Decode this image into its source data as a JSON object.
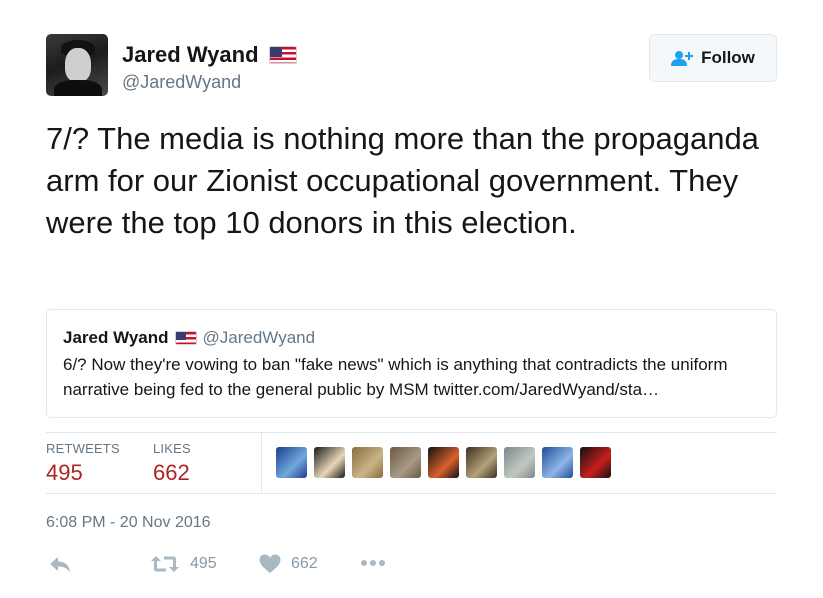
{
  "author": {
    "display_name": "Jared Wyand",
    "handle": "@JaredWyand"
  },
  "follow_button": {
    "label": "Follow"
  },
  "tweet": {
    "text": "7/? The media is nothing more than the propaganda arm for our Zionist occupational government. They were the top 10 donors in this election."
  },
  "quoted_tweet": {
    "display_name": "Jared Wyand",
    "handle": "@JaredWyand",
    "text": "6/? Now they're vowing to ban \"fake news\" which is anything that contradicts the uniform narrative being fed to the general public by MSM twitter.com/JaredWyand/sta…"
  },
  "stats": {
    "retweets_label": "RETWEETS",
    "retweets": "495",
    "likes_label": "LIKES",
    "likes": "662"
  },
  "likers": [
    {
      "name": "liker-avatar-1",
      "colors": [
        "#1d3b8f",
        "#6fa8dc"
      ]
    },
    {
      "name": "liker-avatar-2",
      "colors": [
        "#1a1a1a",
        "#e8d6b8"
      ]
    },
    {
      "name": "liker-avatar-3",
      "colors": [
        "#8a6d3b",
        "#c9b48a"
      ]
    },
    {
      "name": "liker-avatar-4",
      "colors": [
        "#6b5a44",
        "#a89a84"
      ]
    },
    {
      "name": "liker-avatar-5",
      "colors": [
        "#111111",
        "#d9602a"
      ]
    },
    {
      "name": "liker-avatar-6",
      "colors": [
        "#3b2f22",
        "#b3a27a"
      ]
    },
    {
      "name": "liker-avatar-7",
      "colors": [
        "#7a8a8a",
        "#c2c8c0"
      ]
    },
    {
      "name": "liker-avatar-8",
      "colors": [
        "#1f4e99",
        "#8fb4e8"
      ]
    },
    {
      "name": "liker-avatar-9",
      "colors": [
        "#111111",
        "#c81e1e"
      ]
    }
  ],
  "timestamp": "6:08 PM - 20 Nov 2016",
  "actions": {
    "retweet_count": "495",
    "like_count": "662"
  },
  "colors": {
    "stat_value": "#b02323",
    "muted": "#657786",
    "action_icon": "#aab8c2",
    "follow_icon": "#1da1f2"
  }
}
